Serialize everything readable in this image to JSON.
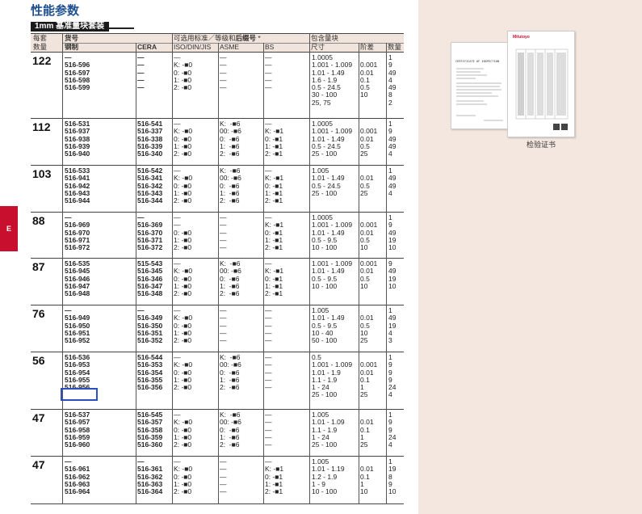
{
  "page_title": "性能参数",
  "subtitle": "1mm 基准量块套装",
  "side_tab_label": "E",
  "header": {
    "blocks_count_line1": "每套",
    "blocks_count_line2": "数量",
    "item_no": "货号",
    "steel": "钢制",
    "cera": "CERA",
    "grade_title_prefix": "可选用标准／等级和",
    "grade_title_bold": "后缀号",
    "grade_title_suffix": " *",
    "iso": "ISO/DIN/JIS",
    "asme": "ASME",
    "bs": "BS",
    "included_blocks": "包含量块",
    "size": "尺寸",
    "step": "阶差",
    "qty": "数量"
  },
  "groups": [
    {
      "count": "122",
      "steel": "—\n516-596\n516-597\n516-598\n516-599",
      "cera": "—\n—\n—\n—\n—",
      "iso": "—\nK: -■0\n0: -■0\n1: -■0\n2: -■0",
      "asme": "—\n—\n—\n—\n—",
      "bs": "—\n—\n—\n—\n—",
      "size": "1.0005\n1.001 - 1.009\n1.01 - 1.49\n1.6 - 1.9\n0.5 - 24.5\n30 - 100\n25, 75",
      "step": "\n0.001\n0.01\n0.1\n0.5\n10",
      "qty": "1\n9\n49\n4\n49\n8\n2"
    },
    {
      "count": "112",
      "steel": "516-531\n516-937\n516-938\n516-939\n516-940",
      "cera": "516-541\n516-337\n516-338\n516-339\n516-340",
      "iso": "—\nK: -■0\n0: -■0\n1: -■0\n2: -■0",
      "asme": "K:  -■6\n00: -■6\n0:  -■6\n1:  -■6\n2:  -■6",
      "bs": "—\nK: -■1\n0: -■1\n1: -■1\n2: -■1",
      "size": "1.0005\n1.001 - 1.009\n1.01 - 1.49\n0.5 - 24.5\n25 - 100",
      "step": "\n0.001\n0.01\n0.5\n25",
      "qty": "1\n9\n49\n49\n4"
    },
    {
      "count": "103",
      "steel": "516-533\n516-941\n516-942\n516-943\n516-944",
      "cera": "516-542\n516-341\n516-342\n516-343\n516-344",
      "iso": "—\nK: -■0\n0: -■0\n1: -■0\n2: -■0",
      "asme": "K:  -■6\n00: -■6\n0:  -■6\n1:  -■6\n2:  -■6",
      "bs": "—\nK: -■1\n0: -■1\n1: -■1\n2: -■1",
      "size": "1.005\n1.01 - 1.49\n0.5 - 24.5\n25 - 100",
      "step": "\n0.01\n0.5\n25",
      "qty": "1\n49\n49\n4"
    },
    {
      "count": "88",
      "steel": "—\n516-969\n516-970\n516-971\n516-972",
      "cera": "—\n516-369\n516-370\n516-371\n516-372",
      "iso": "—\n—\n0: -■0\n1: -■0\n2: -■0",
      "asme": "—\n—\n—\n—\n—",
      "bs": "—\nK: -■1\n0: -■1\n1: -■1\n2: -■1",
      "size": "1.0005\n1.001 - 1.009\n1.01 - 1.49\n0.5 - 9.5\n10 - 100",
      "step": "\n0.001\n0.01\n0.5\n10",
      "qty": "1\n9\n49\n19\n10"
    },
    {
      "count": "87",
      "steel": "516-535\n516-945\n516-946\n516-947\n516-948",
      "cera": "515-543\n516-345\n516-346\n516-347\n516-348",
      "iso": "—\nK: -■0\n0: -■0\n1: -■0\n2: -■0",
      "asme": "K:  -■6\n00: -■6\n0:  -■6\n1:  -■6\n2:  -■6",
      "bs": "—\nK: -■1\n0: -■1\n1: -■1\n2: -■1",
      "size": "1.001 - 1.009\n1.01 - 1.49\n0.5 - 9.5\n10 - 100",
      "step": "0.001\n0.01\n0.5\n10",
      "qty": "9\n49\n19\n10"
    },
    {
      "count": "76",
      "steel": "—\n516-949\n516-950\n516-951\n516-952",
      "cera": "—\n516-349\n516-350\n516-351\n516-352",
      "iso": "—\nK: -■0\n0: -■0\n1: -■0\n2: -■0",
      "asme": "—\n—\n—\n—\n—",
      "bs": "—\n—\n—\n—\n—",
      "size": "1.005\n1.01 - 1.49\n0.5 - 9.5\n10 - 40\n50 - 100",
      "step": "\n0.01\n0.5\n10\n25",
      "qty": "1\n49\n19\n4\n3"
    },
    {
      "count": "56",
      "steel": "516-536\n516-953\n516-954\n516-955\n516-956",
      "cera": "516-544\n516-353\n516-354\n516-355\n516-356",
      "iso": "—\nK: -■0\n0: -■0\n1: -■0\n2: -■0",
      "asme": "K:  -■6\n00: -■6\n0:  -■6\n1:  -■6\n2:  -■6",
      "bs": "—\n—\n—\n—\n—",
      "size": "0.5\n1.001 - 1.009\n1.01 - 1.9\n1.1 - 1.9\n1 - 24\n25 - 100",
      "step": "\n0.001\n0.01\n0.1\n1\n25",
      "qty": "1\n9\n9\n9\n24\n4"
    },
    {
      "count": "47",
      "steel": "516-537\n516-957\n516-958\n516-959\n516-960",
      "cera": "516-545\n516-357\n516-358\n516-359\n516-360",
      "iso": "—\nK: -■0\n0: -■0\n1: -■0\n2: -■0",
      "asme": "K:  -■6\n00: -■6\n0:  -■6\n1:  -■6\n2:  -■6",
      "bs": "—\n—\n—\n—\n—",
      "size": "1.005\n1.01 - 1.09\n1.1 - 1.9\n1 - 24\n25 - 100",
      "step": "\n0.01\n0.1\n1\n25",
      "qty": "1\n9\n9\n24\n4"
    },
    {
      "count": "47",
      "steel": "—\n516-961\n516-962\n516-963\n516-964",
      "cera": "—\n516-361\n516-362\n516-363\n516-364",
      "iso": "—\nK: -■0\n0: -■0\n1: -■0\n2: -■0",
      "asme": "—\n—\n—\n—\n—",
      "bs": "—\nK: -■1\n0: -■1\n1: -■1\n2: -■1",
      "size": "1.005\n1.01 - 1.19\n1.2 - 1.9\n1 - 9\n10 - 100",
      "step": "\n0.01\n0.1\n1\n10",
      "qty": "1\n19\n8\n9\n10"
    }
  ],
  "certificate": {
    "caption": "检验证书",
    "doc_title": "CERTIFICATE OF INSPECTION",
    "brand": "Mitutoyo"
  },
  "highlight_item": "516-956"
}
